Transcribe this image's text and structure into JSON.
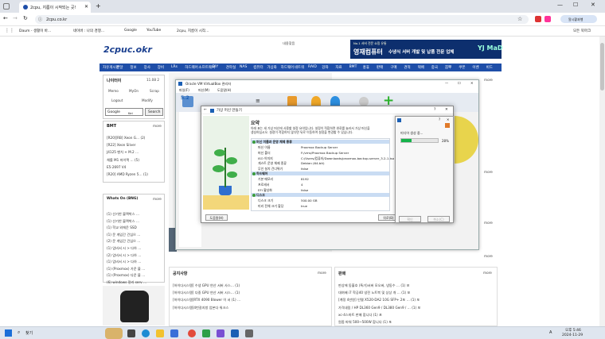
{
  "browser": {
    "tab_title": "2cpu, 지름이 시작되는 곳!",
    "url": "2cpu.co.kr",
    "bookmarks": [
      "Daum - 생활이 바...",
      "네이버 : 나의 경쟁...",
      "Google",
      "YouTube",
      "2cpu, 지름이 시작..."
    ],
    "bookmarks_right": "모든 북마크",
    "extension_label": "알시황과행"
  },
  "site": {
    "logo": "2cpuc.okr",
    "header_links": "내용찾음",
    "banner_small": "No.1 서버 전문 쇼핑 유통",
    "banner_main": "영재컴퓨터",
    "banner_tagline": "수냉식 서버 개발 및 납품 전문 업체",
    "banner_logo": "YJ MaD",
    "nav_items": [
      "자유게시판",
      "전달",
      "정보",
      "장사",
      "장비",
      "LRs",
      "하드웨어",
      "소프트웨어",
      "DIY",
      "견학실",
      "NAS",
      "컴퓨터",
      "가상화",
      "하드웨어",
      "네트워",
      "RAID",
      "강좌",
      "자료",
      "BMT",
      "홍휴",
      "판매",
      "구매",
      "견적",
      "택배",
      "중국",
      "뽐뿌",
      "쿠폰",
      "이벤",
      "비드"
    ],
    "nav_more": "비드 ▾",
    "login_box": {
      "title": "나이터이",
      "meta": "11.08 2",
      "menu": [
        "Memo",
        "MyOn",
        "Scrap",
        "Logout",
        "Modify"
      ],
      "search_value": "Google",
      "search_sub": "Kei",
      "search_button": "Search"
    },
    "bmt_box": {
      "title": "BMT",
      "more": "more",
      "items": [
        "[R20][RB] Xeon G… (2)",
        "[R22] Xeon Silver",
        "J4125 벤치 + M.2 …",
        "체를 M1 마이맥 …  (5)",
        "E5-2697 V4",
        "[R20] AMD Ryzen 5… (1)"
      ]
    },
    "whats_on": {
      "title": "Whats On (BNG)",
      "more": "more",
      "items": [
        "(1) 산기한 블랙박스 …",
        "(1) 산기한 블랙박스 …",
        "(1) 학교 외에운 SSD",
        "(1) 문 게임간 건심으 …",
        "(2) 문 게임간 건심으 …",
        "(1) 업비서 시 > 다하 …",
        "(2) 업비서 시 > 다하 …",
        "(1) 업비서 시 > 다하 …",
        "(1) (Proxmox) 가운 블 …",
        "(1) (Proxmox) 다운 블 …",
        "(6) windows 정리 serv …"
      ]
    },
    "right_col_more": [
      "more",
      "more",
      "more",
      "more"
    ],
    "notice_box": {
      "title": "공지사항",
      "more": "more",
      "items": [
        "[하이다시스템] 수냉 GPU 연산 서버 사스… (1)",
        "[하이다시스템] 다중 GPU 연산 서버 시스… (1)",
        "[하이다시스템]RTX 4090 Blower 이 서 (1) …",
        "[하이다시스템]4번갈지방 업본다 워크스"
      ]
    },
    "sale_box": {
      "title": "판매",
      "more": "more",
      "items": [
        "판상에 동흘호 (특가)서버 모오써, 냉동수 … (1) 포",
        "대여배 i7 학공40 냉전 노트북 및 상상 개 … (1) 포",
        "[계정 4만원] 인텔 X520-DA2 10G SFP+ 2포 … (1) 포",
        "가격내림 / HP DL360 Gen9 / DL380 Gen9 / … (1) 포",
        "xc-4스마트 판매 합니다 (1) 포",
        "원좀 파워 500~500W 합니다 (1) 포"
      ]
    }
  },
  "virtualbox": {
    "title": "Oracle VM VirtualBox 관리자",
    "menu": [
      "파일(F)",
      "머신(M)",
      "도움말(H)"
    ],
    "vm_label": "5.2"
  },
  "wizard": {
    "title": "가상 머신 만들기",
    "help_icon": "?",
    "heading": "요약",
    "description_line1": "아래 표는 새 가상 머신에 사용할 설정 요약입니다. 설정이 적합하면 완료를 눌러서 가상 머신을",
    "description_line2": "생성하십시오. 설정이 적합하지 않다면 뒤로 이동하여 설정을 변경할 수 있습니다.",
    "rows": [
      {
        "group": true,
        "label": "머신 이름과 운영 체제 종류"
      },
      {
        "label": "머신 이름",
        "value": "Proxmox Backup Server"
      },
      {
        "label": "머신 폴더",
        "value": "F:/vms/Proxmox Backup Server"
      },
      {
        "label": "ISO 이미지",
        "value": "C:/Users/컴퓨터/Downloads/proxmox-backup-server_3.2-1.iso"
      },
      {
        "label": "게스트 운영 체제 종류",
        "value": "Debian (64-bit)"
      },
      {
        "label": "무인 설치 건너뛰기",
        "value": "false"
      },
      {
        "group": true,
        "label": "하드웨어"
      },
      {
        "label": "기본 메모리",
        "value": "8192"
      },
      {
        "label": "프로세서",
        "value": "4"
      },
      {
        "label": "EFI 활성화",
        "value": "false"
      },
      {
        "group": true,
        "label": "디스크"
      },
      {
        "label": "디스크 크기",
        "value": "500.00 GB"
      },
      {
        "label": "미리 전체 크기 할당",
        "value": "true"
      }
    ],
    "help_button": "도움말(H)",
    "back_button": "뒤로(B)"
  },
  "progress_dialog": {
    "title": "미디어 생성 중...",
    "percent_text": "28%",
    "percent": 28,
    "cancel_button": "취소(C)",
    "ok_button": "확인"
  },
  "taskbar": {
    "search_label": "찾기",
    "time": "오후 5:46",
    "date": "2024-11-29",
    "lang": "A"
  },
  "colors": {
    "nav_blue": "#1e4ea8",
    "progress_green": "#15b34a",
    "tree_group": "#c9dcf3"
  }
}
